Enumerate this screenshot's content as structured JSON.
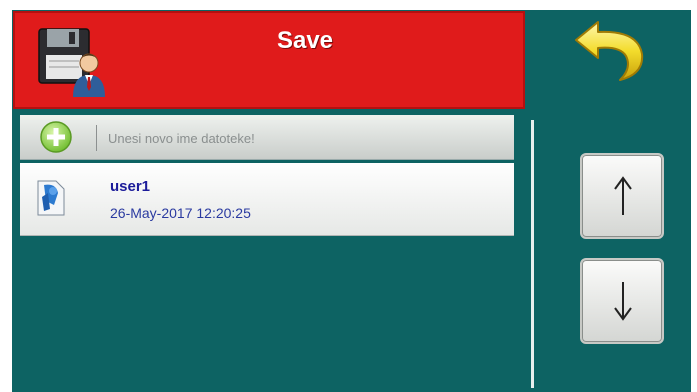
{
  "header": {
    "title": "Save",
    "icon": "save-user-icon",
    "background": "#e01b1b"
  },
  "toolbar": {
    "back_icon": "undo-arrow-icon",
    "scroll_up_icon": "arrow-up-icon",
    "scroll_down_icon": "arrow-down-icon"
  },
  "new_file": {
    "icon": "add-circle-icon",
    "placeholder": "Unesi novo ime datoteke!",
    "value": ""
  },
  "files": [
    {
      "icon": "user-file-icon",
      "name": "user1",
      "date": "26-May-2017 12:20:25"
    }
  ],
  "colors": {
    "background": "#0d6363",
    "accent_red": "#e01b1b",
    "name_blue": "#1c1c9a",
    "date_blue": "#2a3aa0"
  }
}
